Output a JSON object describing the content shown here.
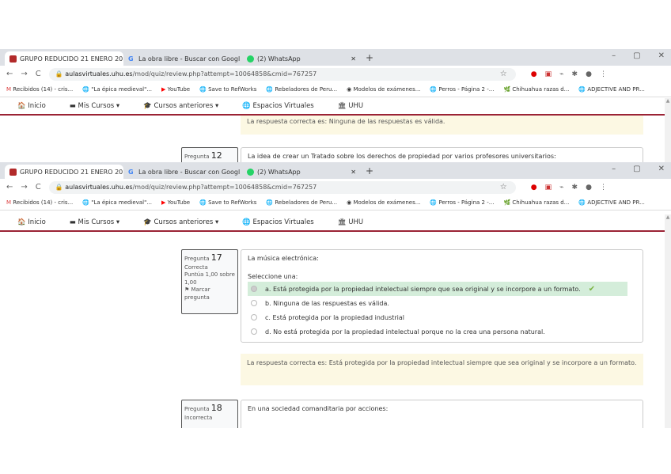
{
  "browser_tabs": [
    {
      "label": "GRUPO REDUCIDO 21 ENERO 20",
      "color": "#b22a2a"
    },
    {
      "label": "La obra libre - Buscar con Googl",
      "color": "#4285f4"
    },
    {
      "label": "(2) WhatsApp",
      "color": "#25d366"
    }
  ],
  "window_controls": {
    "minimize": "–",
    "maximize": "▢",
    "close": "✕"
  },
  "address": {
    "top_url_host": "aulasvirtuales.uhu.es",
    "top_url_path": "/mod/quiz/review.php?attempt=10064858&cmid=767257",
    "bottom_url_host": "aulasvirtuales.uhu.es",
    "bottom_url_path": "/mod/quiz/review.php?attempt=10064858&cmid=767257"
  },
  "bookmarks": [
    "Recibidos (14) - cris...",
    "\"La épica medieval\"...",
    "YouTube",
    "Save to RefWorks",
    "Rebeladores de Peru...",
    "Modelos de exámenes...",
    "Perros - Página 2 -...",
    "Chihuahua razas d...",
    "ADJECTIVE AND PR..."
  ],
  "nav": {
    "items": [
      "Inicio",
      "Mis Cursos ▾",
      "Cursos anteriores ▾",
      "Espacios Virtuales",
      "UHU"
    ]
  },
  "top": {
    "feedback": "La respuesta correcta es: Ninguna de las respuestas es válida.",
    "q12": {
      "label": "Pregunta",
      "number": "12",
      "text": "La idea de crear un Tratado sobre los derechos de propiedad por varios profesores universitarios:"
    }
  },
  "q17": {
    "label": "Pregunta",
    "number": "17",
    "status": "Correcta",
    "score": "Puntúa 1,00 sobre 1,00",
    "flag": "Marcar pregunta",
    "text": "La música electrónica:",
    "prompt": "Seleccione una:",
    "options": [
      "a. Está protegida por la propiedad intelectual siempre que sea original y se incorpore a un formato.",
      "b. Ninguna de las respuestas es válida.",
      "c. Está protegida por la propiedad industrial",
      "d. No está protegida por la propiedad intelectual porque no la crea una persona natural."
    ],
    "selected": 0,
    "feedback": "La respuesta correcta es: Está protegida por la propiedad intelectual siempre que sea original y se incorpore a un formato."
  },
  "q18": {
    "label": "Pregunta",
    "number": "18",
    "status": "Incorrecta",
    "text": "En una sociedad comanditaria por acciones:"
  }
}
